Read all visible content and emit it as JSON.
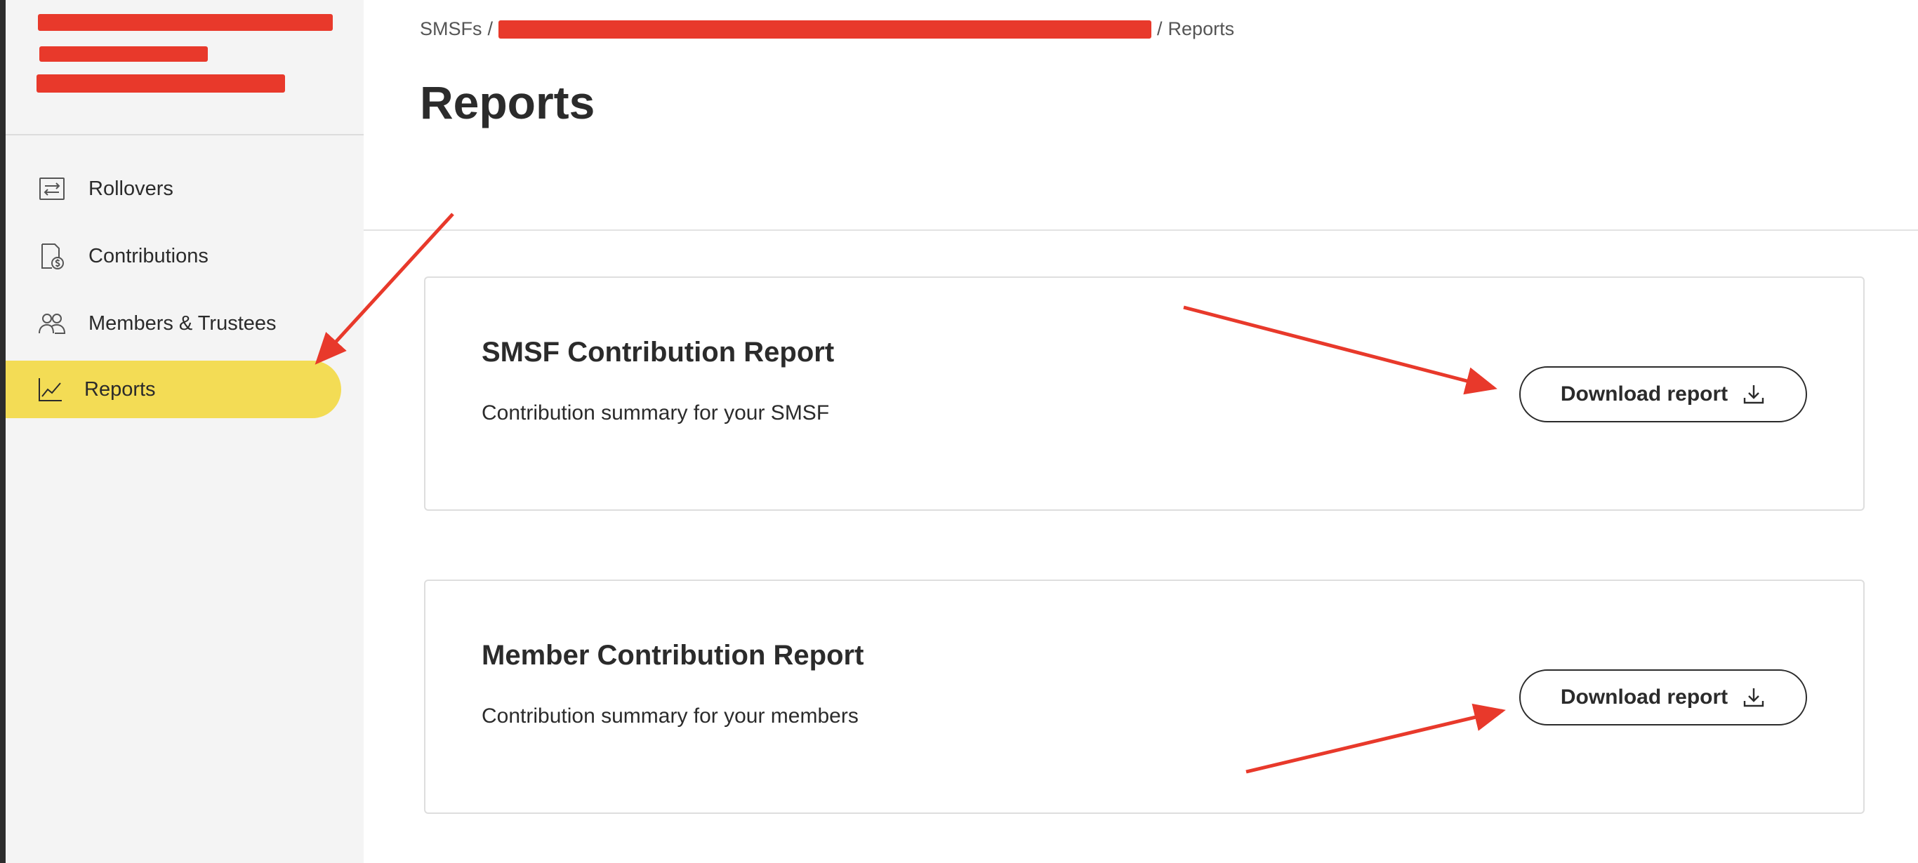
{
  "sidebar": {
    "items": [
      {
        "label": "Rollovers",
        "icon": "transfer-icon",
        "active": false
      },
      {
        "label": "Contributions",
        "icon": "document-dollar-icon",
        "active": false
      },
      {
        "label": "Members & Trustees",
        "icon": "people-icon",
        "active": false
      },
      {
        "label": "Reports",
        "icon": "line-chart-icon",
        "active": true
      }
    ]
  },
  "breadcrumb": {
    "root": "SMSFs",
    "separator": "/",
    "current": "Reports"
  },
  "page": {
    "title": "Reports"
  },
  "reports": [
    {
      "title": "SMSF Contribution Report",
      "description": "Contribution summary for your SMSF",
      "button_label": "Download report",
      "button_icon": "download-icon"
    },
    {
      "title": "Member Contribution Report",
      "description": "Contribution summary for your members",
      "button_label": "Download report",
      "button_icon": "download-icon"
    }
  ],
  "colors": {
    "active_nav": "#f3dc55",
    "sidebar_bg": "#f4f4f4",
    "annotation_red": "#e8392b",
    "text": "#2b2b2b"
  }
}
